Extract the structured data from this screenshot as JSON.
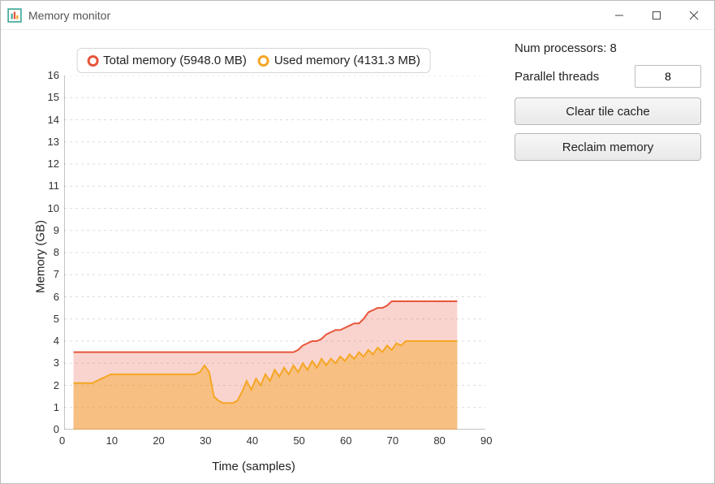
{
  "window": {
    "title": "Memory monitor"
  },
  "sidebar": {
    "num_processors_label": "Num processors: 8",
    "parallel_threads_label": "Parallel threads",
    "parallel_threads_value": "8",
    "clear_cache_label": "Clear tile cache",
    "reclaim_label": "Reclaim memory"
  },
  "legend": {
    "total_label": "Total memory (5948.0 MB)",
    "used_label": "Used memory (4131.3 MB)",
    "total_color": "#e8553a",
    "used_color": "#f5a623"
  },
  "chart": {
    "ylabel": "Memory (GB)",
    "xlabel": "Time (samples)",
    "y_ticks": [
      "0",
      "1",
      "2",
      "3",
      "4",
      "5",
      "6",
      "7",
      "8",
      "9",
      "10",
      "11",
      "12",
      "13",
      "14",
      "15",
      "16"
    ],
    "x_ticks": [
      "0",
      "10",
      "20",
      "30",
      "40",
      "50",
      "60",
      "70",
      "80",
      "90"
    ]
  },
  "chart_data": {
    "type": "area",
    "xlabel": "Time (samples)",
    "ylabel": "Memory (GB)",
    "xlim": [
      0,
      90
    ],
    "ylim": [
      0,
      16
    ],
    "x": [
      2,
      3,
      4,
      5,
      6,
      7,
      8,
      9,
      10,
      11,
      12,
      13,
      14,
      15,
      16,
      17,
      18,
      19,
      20,
      21,
      22,
      23,
      24,
      25,
      26,
      27,
      28,
      29,
      30,
      31,
      32,
      33,
      34,
      35,
      36,
      37,
      38,
      39,
      40,
      41,
      42,
      43,
      44,
      45,
      46,
      47,
      48,
      49,
      50,
      51,
      52,
      53,
      54,
      55,
      56,
      57,
      58,
      59,
      60,
      61,
      62,
      63,
      64,
      65,
      66,
      67,
      68,
      69,
      70,
      71,
      72,
      73,
      74,
      75,
      76,
      77,
      78,
      79,
      80,
      81,
      82,
      83,
      84
    ],
    "series": [
      {
        "name": "Total memory (5948.0 MB)",
        "color": "#e8553a",
        "fill": "rgba(232,85,58,0.25)",
        "values": [
          3.5,
          3.5,
          3.5,
          3.5,
          3.5,
          3.5,
          3.5,
          3.5,
          3.5,
          3.5,
          3.5,
          3.5,
          3.5,
          3.5,
          3.5,
          3.5,
          3.5,
          3.5,
          3.5,
          3.5,
          3.5,
          3.5,
          3.5,
          3.5,
          3.5,
          3.5,
          3.5,
          3.5,
          3.5,
          3.5,
          3.5,
          3.5,
          3.5,
          3.5,
          3.5,
          3.5,
          3.5,
          3.5,
          3.5,
          3.5,
          3.5,
          3.5,
          3.5,
          3.5,
          3.5,
          3.5,
          3.5,
          3.5,
          3.6,
          3.8,
          3.9,
          4.0,
          4.0,
          4.1,
          4.3,
          4.4,
          4.5,
          4.5,
          4.6,
          4.7,
          4.8,
          4.8,
          5.0,
          5.3,
          5.4,
          5.5,
          5.5,
          5.6,
          5.8,
          5.8,
          5.8,
          5.8,
          5.8,
          5.8,
          5.8,
          5.8,
          5.8,
          5.8,
          5.8,
          5.8,
          5.8,
          5.8,
          5.8
        ]
      },
      {
        "name": "Used memory (4131.3 MB)",
        "color": "#f5a623",
        "fill": "rgba(245,166,35,0.45)",
        "values": [
          2.1,
          2.1,
          2.1,
          2.1,
          2.1,
          2.2,
          2.3,
          2.4,
          2.5,
          2.5,
          2.5,
          2.5,
          2.5,
          2.5,
          2.5,
          2.5,
          2.5,
          2.5,
          2.5,
          2.5,
          2.5,
          2.5,
          2.5,
          2.5,
          2.5,
          2.5,
          2.5,
          2.6,
          2.9,
          2.6,
          1.5,
          1.3,
          1.2,
          1.2,
          1.2,
          1.3,
          1.7,
          2.2,
          1.8,
          2.3,
          2.0,
          2.5,
          2.2,
          2.7,
          2.4,
          2.8,
          2.5,
          2.9,
          2.6,
          3.0,
          2.7,
          3.1,
          2.8,
          3.2,
          2.9,
          3.2,
          3.0,
          3.3,
          3.1,
          3.4,
          3.2,
          3.5,
          3.3,
          3.6,
          3.4,
          3.7,
          3.5,
          3.8,
          3.6,
          3.9,
          3.8,
          4.0,
          4.0,
          4.0,
          4.0,
          4.0,
          4.0,
          4.0,
          4.0,
          4.0,
          4.0,
          4.0,
          4.0
        ]
      }
    ]
  }
}
